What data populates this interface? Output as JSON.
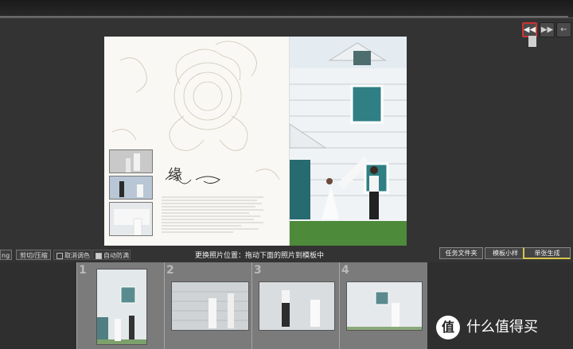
{
  "nav": {
    "icons": [
      "rewind-icon",
      "fast-forward-icon",
      "back-arrow-icon"
    ],
    "rewind_glyph": "◀◀",
    "forward_glyph": "▶▶",
    "back_glyph": "←"
  },
  "toolbar": {
    "partial_left": "ng",
    "crop_label": "剪切/压缩",
    "cancel_tone_label": "取消调色",
    "auto_fill_label": "自动防满",
    "auto_fill_checked": true,
    "cancel_tone_checked": false,
    "hint": "更换照片位置：拖动下面的照片到模板中",
    "task_folder_label": "任务文件夹",
    "template_sample_label": "模板小样",
    "single_generate_label": "单张生成"
  },
  "album": {
    "script_title": "缘"
  },
  "filmstrip": {
    "slots": [
      {
        "number": "1"
      },
      {
        "number": "2"
      },
      {
        "number": "3"
      },
      {
        "number": "4"
      }
    ]
  },
  "watermark": {
    "logo_glyph": "值",
    "text": "什么值得买"
  },
  "colors": {
    "background": "#333333",
    "accent_yellow": "#d9c64a",
    "active_red": "#cc3333"
  }
}
